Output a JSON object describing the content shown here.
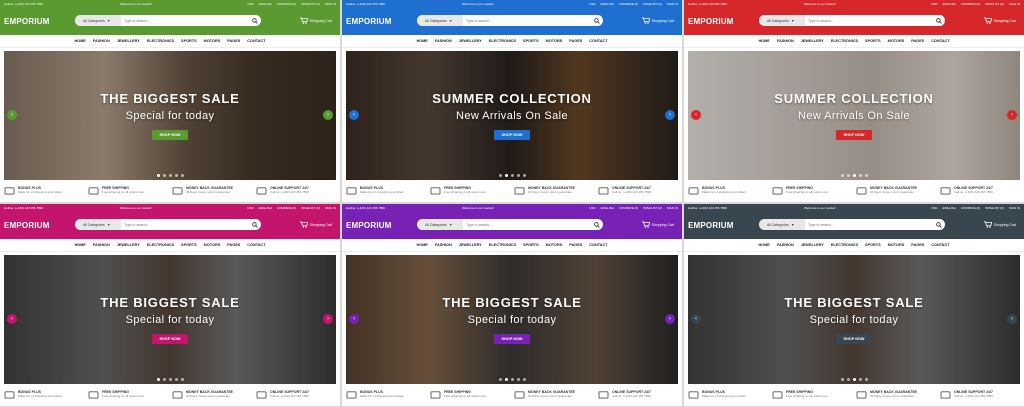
{
  "topbar": {
    "hotline": "Hotline: (+100) 123 456 7890",
    "welcome": "Welcome to our market!",
    "currency": "USD",
    "language": "ENGLISH",
    "compare": "COMPARE (0)",
    "wishlist": "WISHLIST (0)",
    "signin": "SIGN IN"
  },
  "header": {
    "logo": "EMPORIUM",
    "category_label": "All Categories",
    "search_placeholder": "Type to search...",
    "cart_label": "Shopping Cart"
  },
  "nav": [
    "HOME",
    "FASHION",
    "JEWELLERY",
    "ELECTRONICS",
    "SPORTS",
    "MOTORS",
    "PAGES",
    "CONTACT"
  ],
  "features": [
    {
      "title": "BONUS PLUS",
      "desc": "Make fun of shopping and collect"
    },
    {
      "title": "FREE SHIPPING",
      "desc": "Free shipping on all orders over"
    },
    {
      "title": "MONEY BACK GUARANTEE",
      "desc": "30 Days money return guarantee"
    },
    {
      "title": "ONLINE SUPPORT 24/7",
      "desc": "Call us: (+100) 123 456 7890"
    }
  ],
  "shop_now": "SHOP NOW",
  "panels": [
    {
      "theme": "#5a9a31",
      "title": "THE BIGGEST SALE",
      "subtitle": "Special for today",
      "scene": "bags",
      "active_dot": 0
    },
    {
      "theme": "#1f6fd1",
      "title": "SUMMER COLLECTION",
      "subtitle": "New Arrivals On Sale",
      "scene": "shoes",
      "active_dot": 1
    },
    {
      "theme": "#d6272a",
      "title": "SUMMER COLLECTION",
      "subtitle": "New Arrivals On Sale",
      "scene": "heels",
      "active_dot": 2
    },
    {
      "theme": "#c2156b",
      "title": "THE BIGGEST SALE",
      "subtitle": "Special for today",
      "scene": "watch",
      "active_dot": 0
    },
    {
      "theme": "#7722b5",
      "title": "THE BIGGEST SALE",
      "subtitle": "Special for today",
      "scene": "store",
      "active_dot": 1
    },
    {
      "theme": "#38474f",
      "title": "THE BIGGEST SALE",
      "subtitle": "Special for today",
      "scene": "watch",
      "active_dot": 2
    }
  ]
}
